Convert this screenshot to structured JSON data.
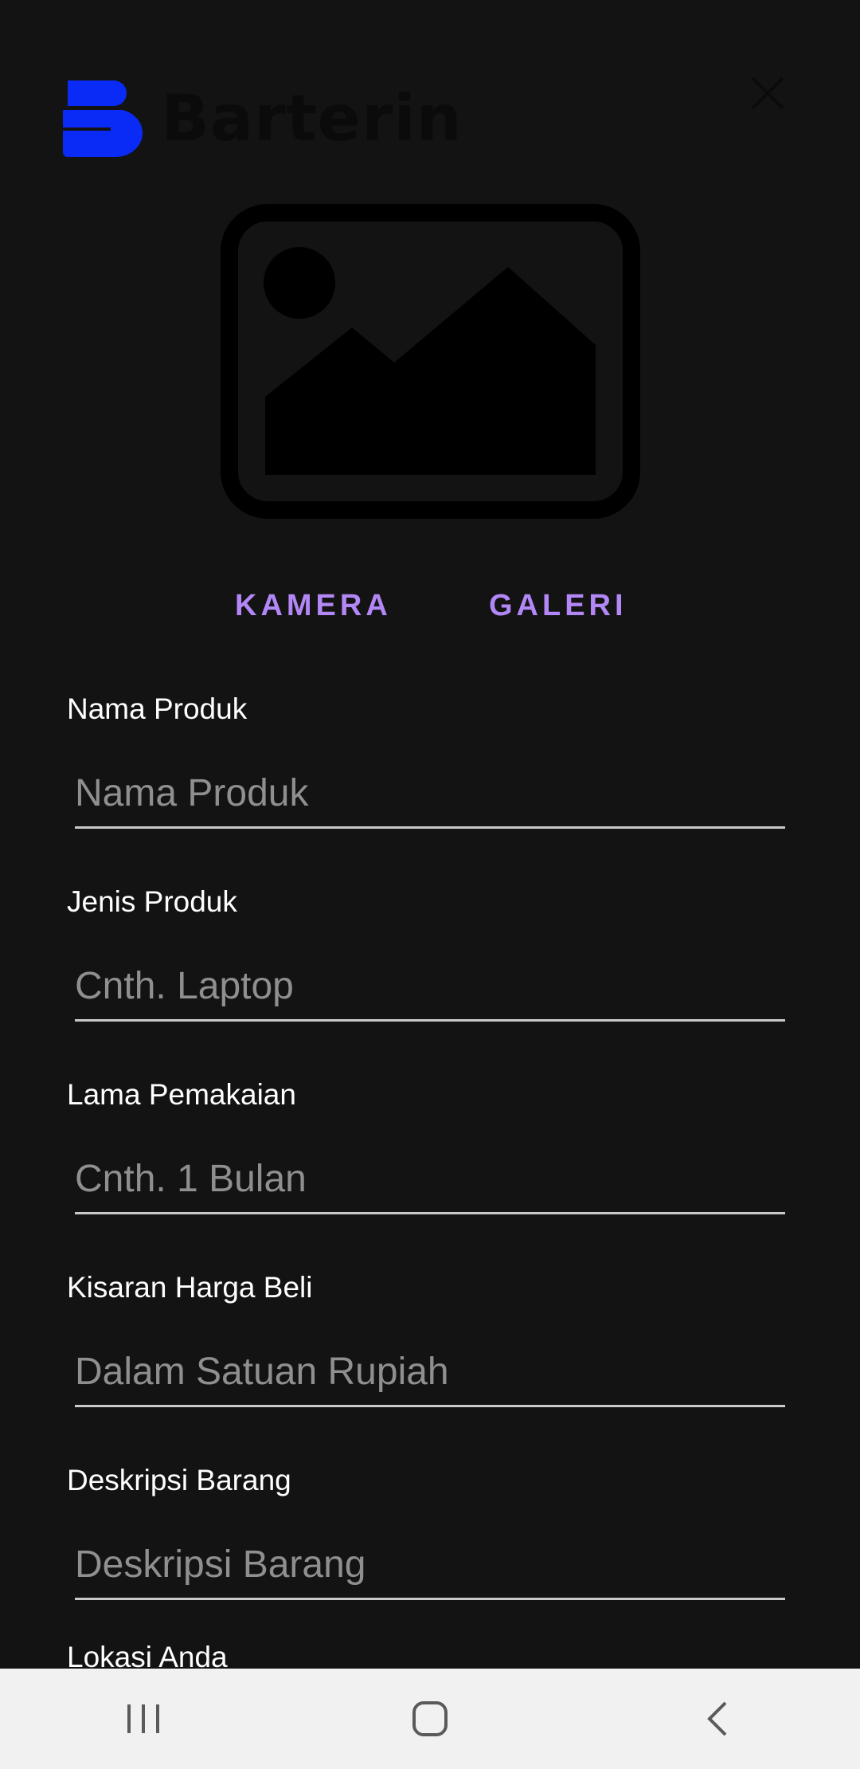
{
  "header": {
    "app_name": "Barterin",
    "logo_icon": "barterin-logo-icon",
    "close_icon": "close-icon"
  },
  "image_picker": {
    "placeholder_icon": "image-placeholder-icon",
    "camera_label": "KAMERA",
    "gallery_label": "GALERI"
  },
  "form": {
    "fields": [
      {
        "label": "Nama Produk",
        "placeholder": "Nama Produk"
      },
      {
        "label": "Jenis Produk",
        "placeholder": "Cnth. Laptop"
      },
      {
        "label": "Lama Pemakaian",
        "placeholder": "Cnth. 1 Bulan"
      },
      {
        "label": "Kisaran Harga Beli",
        "placeholder": "Dalam Satuan Rupiah"
      },
      {
        "label": "Deskripsi Barang",
        "placeholder": "Deskripsi Barang"
      },
      {
        "label": "Lokasi Anda"
      }
    ]
  },
  "navbar": {
    "recent_icon": "recent-apps-icon",
    "home_icon": "home-icon",
    "back_icon": "back-icon"
  },
  "colors": {
    "background": "#131314",
    "accent": "#b387f5",
    "logo_blue": "#0a2bf5",
    "navbar_bg": "#f1f1f1"
  }
}
